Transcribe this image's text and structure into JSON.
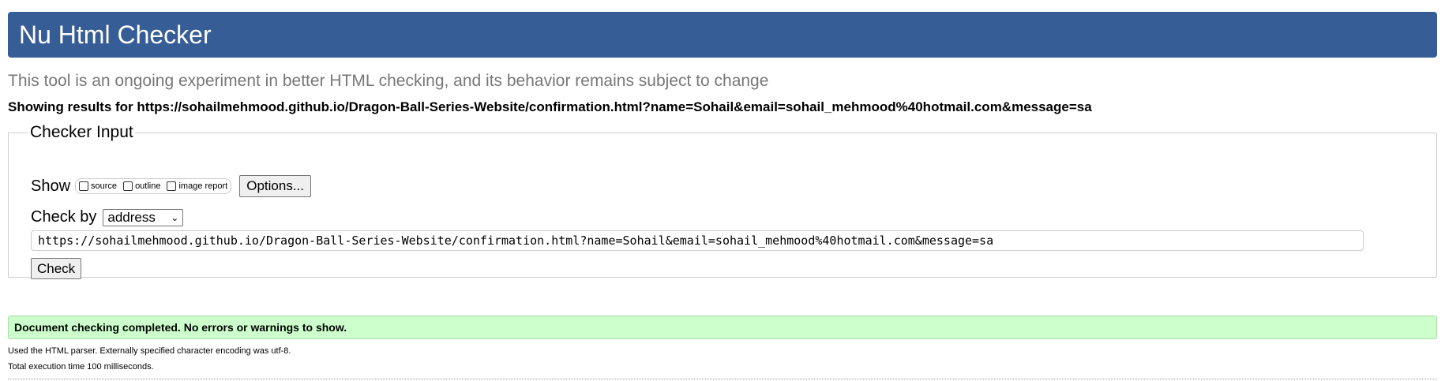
{
  "header": {
    "title": "Nu Html Checker"
  },
  "tagline": "This tool is an ongoing experiment in better HTML checking, and its behavior remains subject to change",
  "results_for": "Showing results for https://sohailmehmood.github.io/Dragon-Ball-Series-Website/confirmation.html?name=Sohail&email=sohail_mehmood%40hotmail.com&message=sa",
  "checker_input": {
    "legend": "Checker Input",
    "show_label": "Show",
    "show_options": [
      {
        "label": "source",
        "checked": false
      },
      {
        "label": "outline",
        "checked": false
      },
      {
        "label": "image report",
        "checked": false
      }
    ],
    "options_button": "Options...",
    "check_by_label": "Check by",
    "check_by_value": "address",
    "url_value": "https://sohailmehmood.github.io/Dragon-Ball-Series-Website/confirmation.html?name=Sohail&email=sohail_mehmood%40hotmail.com&message=sa",
    "check_button": "Check"
  },
  "result": {
    "success_message": "Document checking completed. No errors or warnings to show.",
    "parser_info": "Used the HTML parser. Externally specified character encoding was utf-8.",
    "execution_time": "Total execution time 100 milliseconds."
  },
  "colors": {
    "header_bg": "#365d95",
    "success_bg": "#ccffcc",
    "tagline": "#777777"
  },
  "icons": {
    "select_arrow": "chevron-down-icon"
  }
}
